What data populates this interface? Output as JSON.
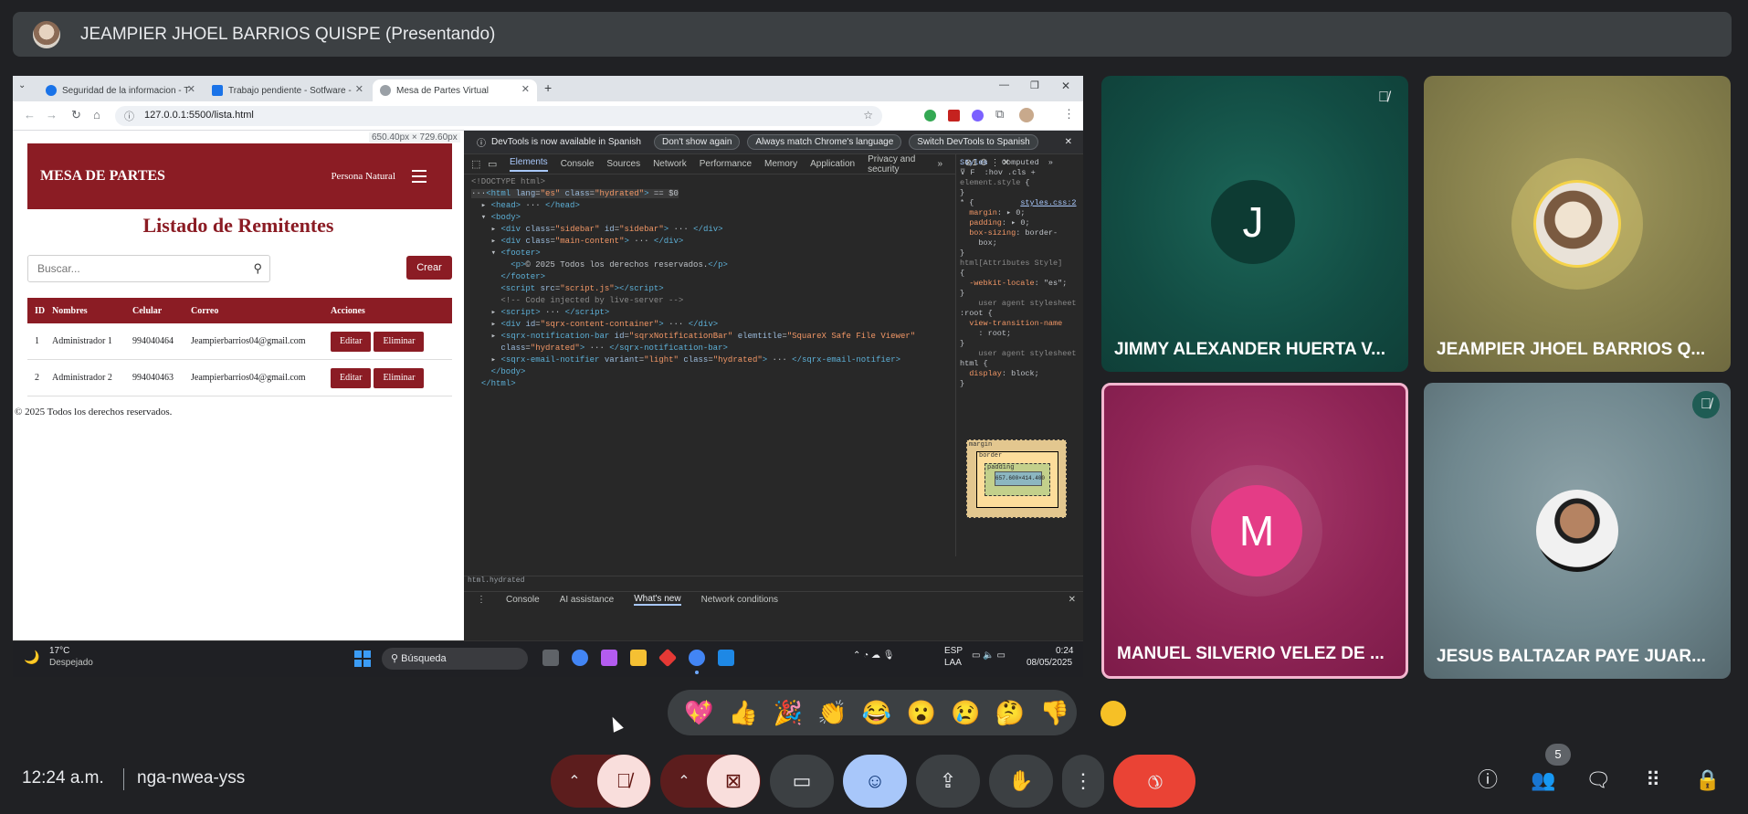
{
  "meeting": {
    "presenter_title": "JEAMPIER JHOEL BARRIOS QUISPE (Presentando)",
    "time": "12:24 a.m.",
    "code": "nga-nwea-yss",
    "participant_count": "5"
  },
  "browser": {
    "tabs": [
      {
        "label": "Seguridad de la informacion - T",
        "fav_color": "#1a73e8"
      },
      {
        "label": "Trabajo pendiente - Sotfware -",
        "fav_color": "#1a73e8"
      },
      {
        "label": "Mesa de Partes Virtual",
        "fav_color": "#5f6368"
      }
    ],
    "url": "127.0.0.1:5500/lista.html",
    "dims": "650.40px × 729.60px"
  },
  "webpage": {
    "brand": "MESA DE PARTES",
    "persona": "Persona Natural",
    "list_title": "Listado de Remitentes",
    "search_placeholder": "Buscar...",
    "crear": "Crear",
    "columns": [
      "ID",
      "Nombres",
      "Celular",
      "Correo",
      "Acciones"
    ],
    "rows": [
      {
        "id": "1",
        "nombre": "Administrador 1",
        "celular": "994040464",
        "correo": "Jeampierbarrios04@gmail.com"
      },
      {
        "id": "2",
        "nombre": "Administrador 2",
        "celular": "994040463",
        "correo": "Jeampierbarrios04@gmail.com"
      }
    ],
    "edit_label": "Editar",
    "delete_label": "Eliminar",
    "footer": "© 2025 Todos los derechos reservados."
  },
  "devtools": {
    "infobar_text": "DevTools is now available in Spanish",
    "btn_dont_show": "Don't show again",
    "btn_match": "Always match Chrome's language",
    "btn_switch": "Switch DevTools to Spanish",
    "tabs": [
      "Elements",
      "Console",
      "Sources",
      "Network",
      "Performance",
      "Memory",
      "Application",
      "Privacy and security"
    ],
    "side_tabs": [
      "Styles",
      "Computed"
    ],
    "status": "html.hydrated",
    "drawer_tabs": [
      "Console",
      "AI assistance",
      "What's new",
      "Network conditions"
    ],
    "box_content": "657.600×414.400"
  },
  "taskbar": {
    "weather_temp": "17°C",
    "weather_desc": "Despejado",
    "search": "Búsqueda",
    "lang_1": "ESP",
    "lang_2": "LAA",
    "time": "0:24",
    "date": "08/05/2025"
  },
  "participants": [
    {
      "name": "JIMMY ALEXANDER HUERTA V...",
      "initial": "J",
      "muted": true
    },
    {
      "name": "JEAMPIER JHOEL BARRIOS Q...",
      "initial": "",
      "muted": false
    },
    {
      "name": "MANUEL SILVERIO VELEZ DE ...",
      "initial": "M",
      "muted": false
    },
    {
      "name": "JESUS BALTAZAR PAYE JUAR...",
      "initial": "",
      "muted": true
    }
  ],
  "reactions": [
    "💖",
    "👍",
    "🎉",
    "👏",
    "😂",
    "😮",
    "😢",
    "🤔",
    "👎"
  ],
  "colors": {
    "brand_red": "#8b1c24",
    "hangup": "#ea4335",
    "meet_bg": "#202124"
  }
}
